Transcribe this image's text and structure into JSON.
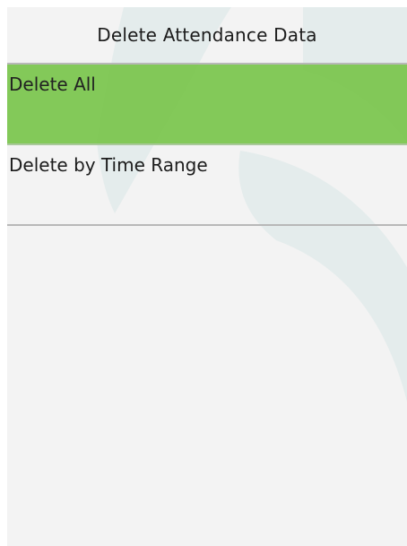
{
  "screen": {
    "title": "Delete Attendance Data",
    "accent_color": "#7cc650",
    "background_color": "#f3f3f3"
  },
  "menu": {
    "items": [
      {
        "label": "Delete All",
        "selected": true
      },
      {
        "label": "Delete by Time Range",
        "selected": false
      }
    ]
  }
}
